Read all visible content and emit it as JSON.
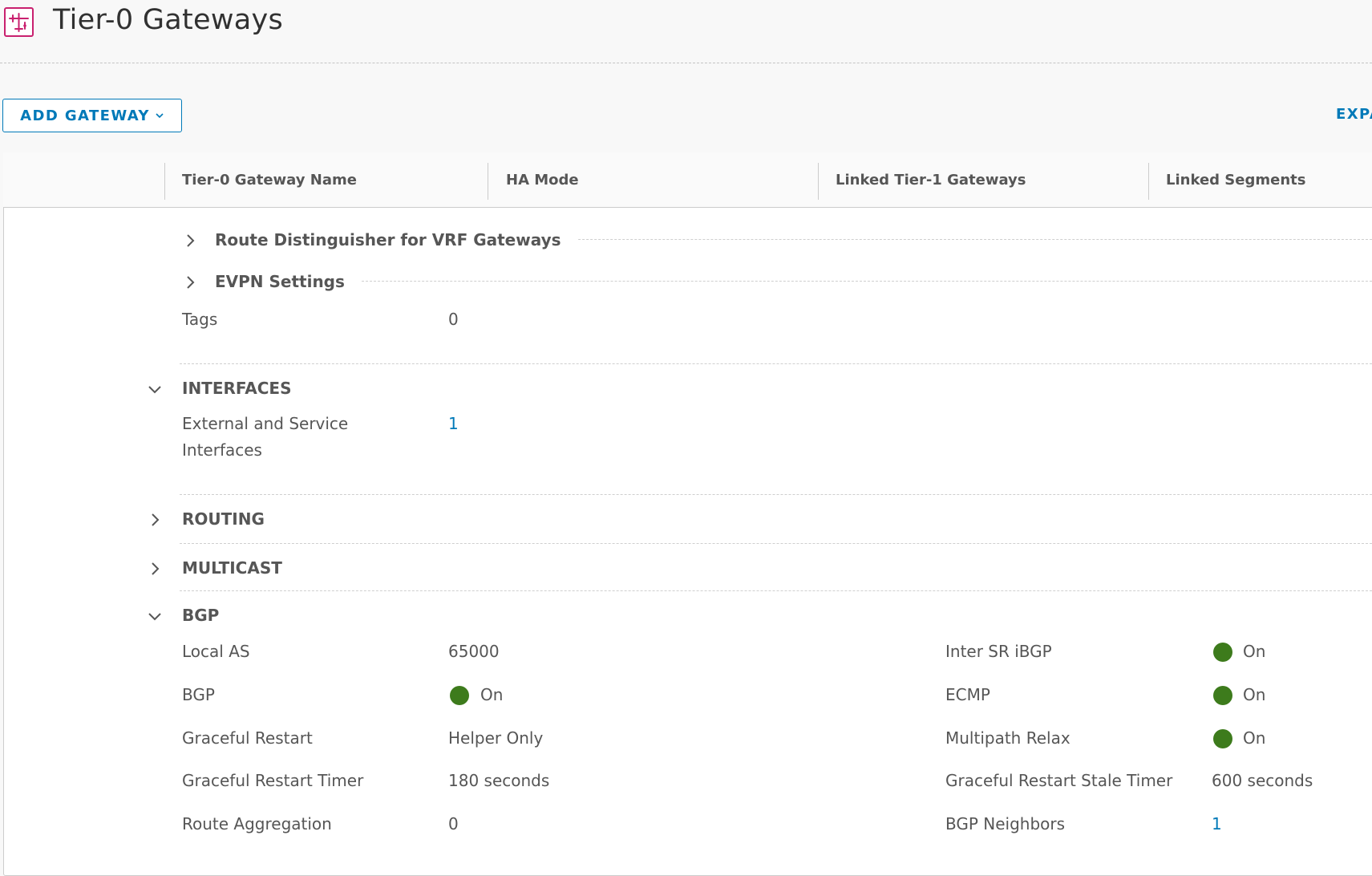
{
  "header": {
    "title": "Tier-0 Gateways",
    "icon": "tier0-gateway-icon",
    "accent_color": "#c9216f"
  },
  "toolbar": {
    "add_gateway_label": "ADD GATEWAY",
    "expand_label": "EXPA"
  },
  "grid": {
    "columns": [
      "Tier-0 Gateway Name",
      "HA Mode",
      "Linked Tier-1 Gateways",
      "Linked Segments"
    ]
  },
  "details": {
    "route_distinguisher_label": "Route Distinguisher for VRF Gateways",
    "evpn_label": "EVPN Settings",
    "tags_label": "Tags",
    "tags_value": "0"
  },
  "interfaces": {
    "section_label": "INTERFACES",
    "ext_label_line1": "External and Service",
    "ext_label_line2": "Interfaces",
    "ext_value": "1"
  },
  "routing": {
    "section_label": "ROUTING"
  },
  "multicast": {
    "section_label": "MULTICAST"
  },
  "bgp": {
    "section_label": "BGP",
    "status_color": "#3d7b1c",
    "local_as_label": "Local AS",
    "local_as_value": "65000",
    "bgp_label": "BGP",
    "bgp_value": "On",
    "graceful_restart_label": "Graceful Restart",
    "graceful_restart_value": "Helper Only",
    "gr_timer_label": "Graceful Restart Timer",
    "gr_timer_value": "180 seconds",
    "route_agg_label": "Route Aggregation",
    "route_agg_value": "0",
    "inter_sr_label": "Inter SR iBGP",
    "inter_sr_value": "On",
    "ecmp_label": "ECMP",
    "ecmp_value": "On",
    "multipath_label": "Multipath Relax",
    "multipath_value": "On",
    "gr_stale_label": "Graceful Restart Stale Timer",
    "gr_stale_value": "600 seconds",
    "neighbors_label": "BGP Neighbors",
    "neighbors_value": "1"
  }
}
